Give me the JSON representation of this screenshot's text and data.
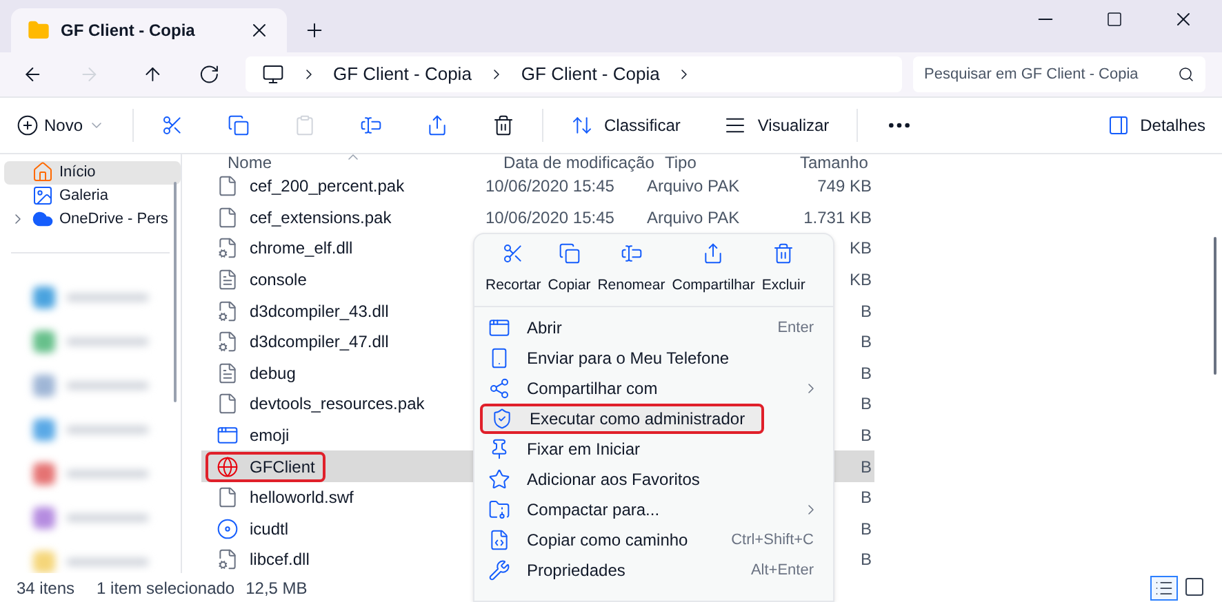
{
  "window": {
    "tab_title": "GF Client - Copia"
  },
  "address": {
    "crumbs": [
      "GF Client - Copia",
      "GF Client - Copia"
    ],
    "search_placeholder": "Pesquisar em GF Client - Copia"
  },
  "command_bar": {
    "new": "Novo",
    "sort": "Classificar",
    "view": "Visualizar",
    "details": "Detalhes"
  },
  "sidebar": {
    "items": [
      {
        "label": "Início",
        "selected": true,
        "expandable": false
      },
      {
        "label": "Galeria",
        "selected": false,
        "expandable": false
      },
      {
        "label": "OneDrive - Pers",
        "selected": false,
        "expandable": true
      }
    ]
  },
  "table": {
    "columns": [
      "Nome",
      "Data de modificação",
      "Tipo",
      "Tamanho"
    ],
    "rows": [
      {
        "name": "cef_200_percent.pak",
        "kind": "blank",
        "date": "10/06/2020 15:45",
        "type": "Arquivo PAK",
        "size": "749 KB",
        "selected": false,
        "highlighted": false
      },
      {
        "name": "cef_extensions.pak",
        "kind": "blank",
        "date": "10/06/2020 15:45",
        "type": "Arquivo PAK",
        "size": "1.731 KB",
        "selected": false,
        "highlighted": false
      },
      {
        "name": "chrome_elf.dll",
        "kind": "gear",
        "size": "KB",
        "selected": false,
        "highlighted": false
      },
      {
        "name": "console",
        "kind": "text",
        "size": "KB",
        "selected": false,
        "highlighted": false
      },
      {
        "name": "d3dcompiler_43.dll",
        "kind": "gear",
        "size": "B",
        "selected": false,
        "highlighted": false
      },
      {
        "name": "d3dcompiler_47.dll",
        "kind": "gear",
        "size": "B",
        "selected": false,
        "highlighted": false
      },
      {
        "name": "debug",
        "kind": "text",
        "size": "B",
        "selected": false,
        "highlighted": false
      },
      {
        "name": "devtools_resources.pak",
        "kind": "blank",
        "size": "B",
        "selected": false,
        "highlighted": false
      },
      {
        "name": "emoji",
        "kind": "app",
        "size": "B",
        "selected": false,
        "highlighted": false
      },
      {
        "name": "GFClient",
        "kind": "exe",
        "size": "B",
        "selected": true,
        "highlighted": true
      },
      {
        "name": "helloworld.swf",
        "kind": "blank",
        "size": "B",
        "selected": false,
        "highlighted": false
      },
      {
        "name": "icudtl",
        "kind": "data",
        "size": "B",
        "selected": false,
        "highlighted": false
      },
      {
        "name": "libcef.dll",
        "kind": "gear",
        "size": "B",
        "selected": false,
        "highlighted": false
      }
    ]
  },
  "context_menu": {
    "actions": [
      "Recortar",
      "Copiar",
      "Renomear",
      "Compartilhar",
      "Excluir"
    ],
    "items": [
      {
        "label": "Abrir",
        "shortcut": "Enter",
        "submenu": false,
        "highlighted": false
      },
      {
        "label": "Enviar para o Meu Telefone",
        "submenu": false,
        "highlighted": false
      },
      {
        "label": "Compartilhar com",
        "submenu": true,
        "highlighted": false
      },
      {
        "label": "Executar como administrador",
        "submenu": false,
        "highlighted": true
      },
      {
        "label": "Fixar em Iniciar",
        "submenu": false,
        "highlighted": false
      },
      {
        "label": "Adicionar aos Favoritos",
        "submenu": false,
        "highlighted": false
      },
      {
        "label": "Compactar para...",
        "submenu": true,
        "highlighted": false
      },
      {
        "label": "Copiar como caminho",
        "shortcut": "Ctrl+Shift+C",
        "submenu": false,
        "highlighted": false
      },
      {
        "label": "Propriedades",
        "shortcut": "Alt+Enter",
        "submenu": false,
        "highlighted": false
      }
    ]
  },
  "status_bar": {
    "count": "34 itens",
    "selection": "1 item selecionado",
    "size": "12,5 MB"
  }
}
